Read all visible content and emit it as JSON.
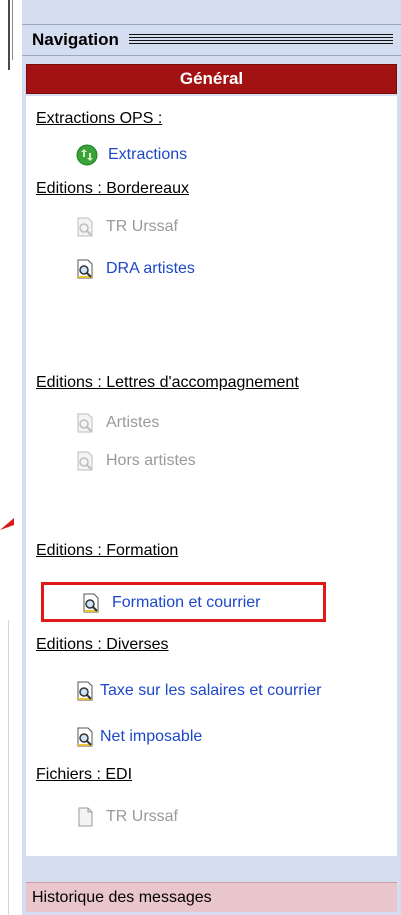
{
  "nav": {
    "title": "Navigation"
  },
  "section": {
    "label": "Général"
  },
  "groups": {
    "ops": {
      "header": "Extractions OPS :",
      "items": [
        {
          "label": "Extractions"
        }
      ]
    },
    "bordereaux": {
      "header": "Editions : Bordereaux",
      "items": [
        {
          "label": "TR Urssaf"
        },
        {
          "label": "DRA artistes"
        }
      ]
    },
    "lettres": {
      "header": "Editions : Lettres d'accompagnement",
      "items": [
        {
          "label": "Artistes"
        },
        {
          "label": "Hors artistes"
        }
      ]
    },
    "formation": {
      "header": "Editions : Formation",
      "items": [
        {
          "label": "Formation et courrier"
        }
      ]
    },
    "diverses": {
      "header": "Editions : Diverses",
      "items": [
        {
          "label": "Taxe sur les salaires et courrier"
        },
        {
          "label": "Net imposable"
        }
      ]
    },
    "edi": {
      "header": "Fichiers : EDI",
      "items": [
        {
          "label": "TR Urssaf"
        }
      ]
    }
  },
  "footer": {
    "label": "Historique des messages"
  },
  "colors": {
    "accent_red": "#a31212",
    "link_blue": "#1d48c8",
    "highlight_red": "#e01818"
  },
  "icons": {
    "extract": "green-refresh-icon",
    "report": "magnifier-document-icon",
    "file": "document-icon"
  }
}
